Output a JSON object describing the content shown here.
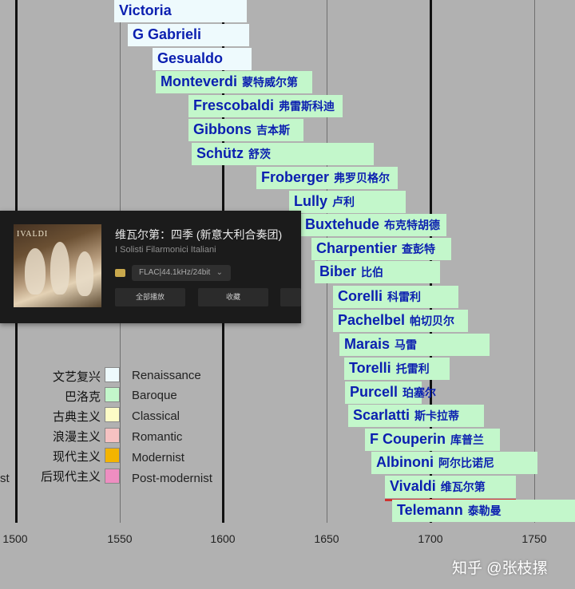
{
  "timeline": {
    "x_axis": {
      "ticks": [
        "1500",
        "1550",
        "1600",
        "1650",
        "1700",
        "1750"
      ]
    },
    "composers": [
      {
        "name": "Victoria",
        "cn": "",
        "era": "Renaissance"
      },
      {
        "name": "G Gabrieli",
        "cn": "",
        "era": "Renaissance"
      },
      {
        "name": "Gesualdo",
        "cn": "",
        "era": "Renaissance"
      },
      {
        "name": "Monteverdi",
        "cn": "蒙特威尔第",
        "era": "Baroque"
      },
      {
        "name": "Frescobaldi",
        "cn": "弗雷斯科迪",
        "era": "Baroque"
      },
      {
        "name": "Gibbons",
        "cn": "吉本斯",
        "era": "Baroque"
      },
      {
        "name": "Schütz",
        "cn": "舒茨",
        "era": "Baroque"
      },
      {
        "name": "Froberger",
        "cn": "弗罗贝格尔",
        "era": "Baroque"
      },
      {
        "name": "Lully",
        "cn": "卢利",
        "era": "Baroque"
      },
      {
        "name": "Buxtehude",
        "cn": "布克特胡德",
        "era": "Baroque"
      },
      {
        "name": "Charpentier",
        "cn": "查彭特",
        "era": "Baroque"
      },
      {
        "name": "Biber",
        "cn": "比伯",
        "era": "Baroque"
      },
      {
        "name": "Corelli",
        "cn": "科雷利",
        "era": "Baroque"
      },
      {
        "name": "Pachelbel",
        "cn": "帕切贝尔",
        "era": "Baroque"
      },
      {
        "name": "Marais",
        "cn": "马雷",
        "era": "Baroque"
      },
      {
        "name": "Torelli",
        "cn": "托雷利",
        "era": "Baroque"
      },
      {
        "name": "Purcell",
        "cn": "珀塞尔",
        "era": "Baroque"
      },
      {
        "name": "Scarlatti",
        "cn": "斯卡拉蒂",
        "era": "Baroque"
      },
      {
        "name": "F Couperin",
        "cn": "库普兰",
        "era": "Baroque"
      },
      {
        "name": "Albinoni",
        "cn": "阿尔比诺尼",
        "era": "Baroque"
      },
      {
        "name": "Vivaldi",
        "cn": "维瓦尔第",
        "era": "Baroque"
      },
      {
        "name": "Telemann",
        "cn": "泰勒曼",
        "era": "Baroque"
      }
    ],
    "highlighted": "Vivaldi",
    "left_cut_text": "st"
  },
  "legend": [
    {
      "cn": "文艺复兴",
      "en": "Renaissance",
      "color": "#eefafd"
    },
    {
      "cn": "巴洛克",
      "en": "Baroque",
      "color": "#c3f7cb"
    },
    {
      "cn": "古典主义",
      "en": "Classical",
      "color": "#fdfbc6"
    },
    {
      "cn": "浪漫主义",
      "en": "Romantic",
      "color": "#f6c2c2"
    },
    {
      "cn": "现代主义",
      "en": "Modernist",
      "color": "#f4b400"
    },
    {
      "cn": "后现代主义",
      "en": "Post-modernist",
      "color": "#ee8ec1"
    }
  ],
  "colors": {
    "bar_text": "#0b1fb0",
    "highlight": "#d0312d"
  },
  "player": {
    "cover_label": "IVALDI",
    "title": "维瓦尔第：四季 (新意大利合奏团)",
    "artist": "I Solisti Filarmonici Italiani",
    "quality_icon": "hq-badge-icon",
    "format": "FLAC|44.1kHz/24bit",
    "buttons": [
      "全部播放",
      "收藏",
      ""
    ]
  },
  "watermark": "知乎 @张枝摞"
}
